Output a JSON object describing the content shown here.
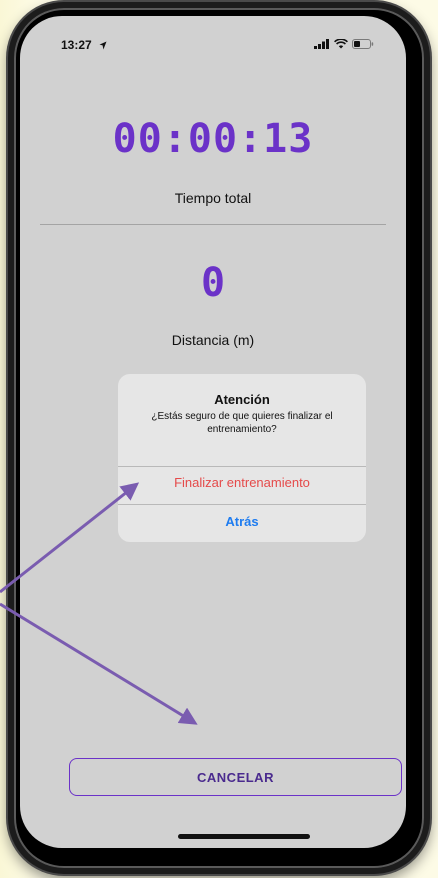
{
  "status_bar": {
    "time": "13:27",
    "location_icon": "location-arrow-icon",
    "signal_icon": "signal-bars-icon",
    "wifi_icon": "wifi-icon",
    "battery_icon": "battery-icon"
  },
  "workout": {
    "timer_value": "00:00:13",
    "timer_label": "Tiempo total",
    "distance_value": "0",
    "distance_label": "Distancia (m)"
  },
  "alert": {
    "title": "Atención",
    "message": "¿Estás seguro de que quieres finalizar el entrenamiento?",
    "destructive_label": "Finalizar entrenamiento",
    "back_label": "Atrás"
  },
  "footer": {
    "cancel_label": "CANCELAR"
  },
  "colors": {
    "accent_purple": "#6b32c8",
    "destructive_red": "#e54a4a",
    "link_blue": "#1e7cf0",
    "annotation_arrow": "#7a5cb0",
    "screen_bg": "#d1d1d1"
  }
}
